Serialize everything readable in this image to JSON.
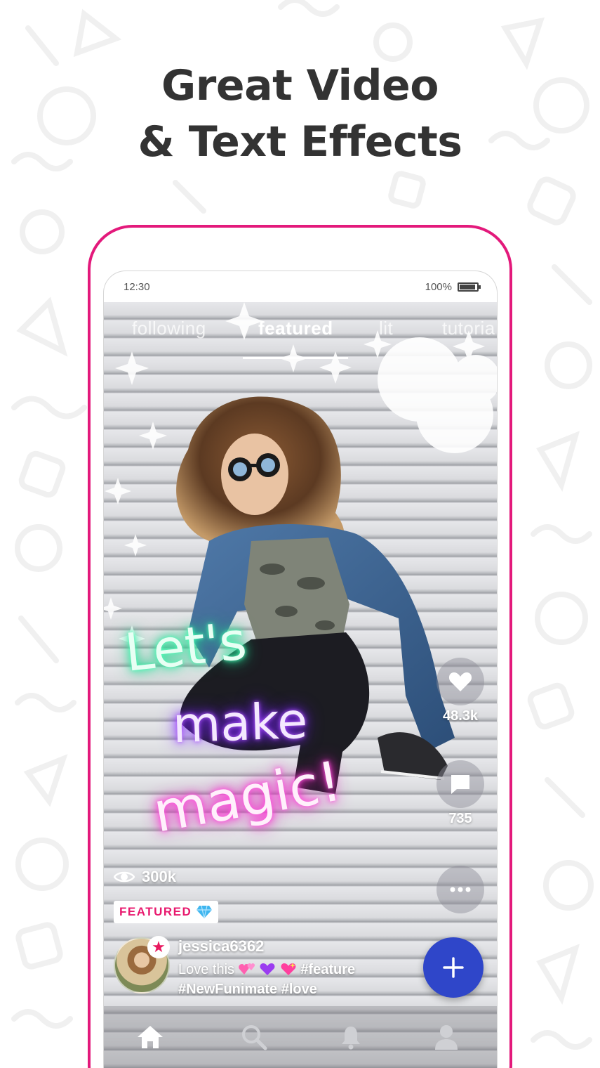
{
  "headline": {
    "line1": "Great Video",
    "line2": "& Text Effects"
  },
  "status_bar": {
    "time": "12:30",
    "battery": "100%"
  },
  "tabs": [
    {
      "label": "following",
      "active": false
    },
    {
      "label": "featured",
      "active": true
    },
    {
      "label": "lit",
      "active": false
    },
    {
      "label": "tutoria",
      "active": false
    }
  ],
  "overlay_text": {
    "line1": "Let's",
    "line2": "make",
    "line3": "magic!"
  },
  "actions": {
    "likes": "48.3k",
    "comments": "735",
    "like_icon": "heart-icon",
    "comment_icon": "comment-icon",
    "more_icon": "more-icon"
  },
  "views": "300k",
  "featured_badge": "FEATURED",
  "post": {
    "username": "jessica6362",
    "caption_text": "Love this",
    "caption_tag1": "#feature",
    "caption_line2": "#NewFunimate #love"
  },
  "colors": {
    "brand_pink": "#e3197b",
    "fab_blue": "#2f46c9",
    "featured_red": "#e8196e"
  },
  "nav": [
    "home-icon",
    "search-icon",
    "bell-icon",
    "profile-icon"
  ]
}
